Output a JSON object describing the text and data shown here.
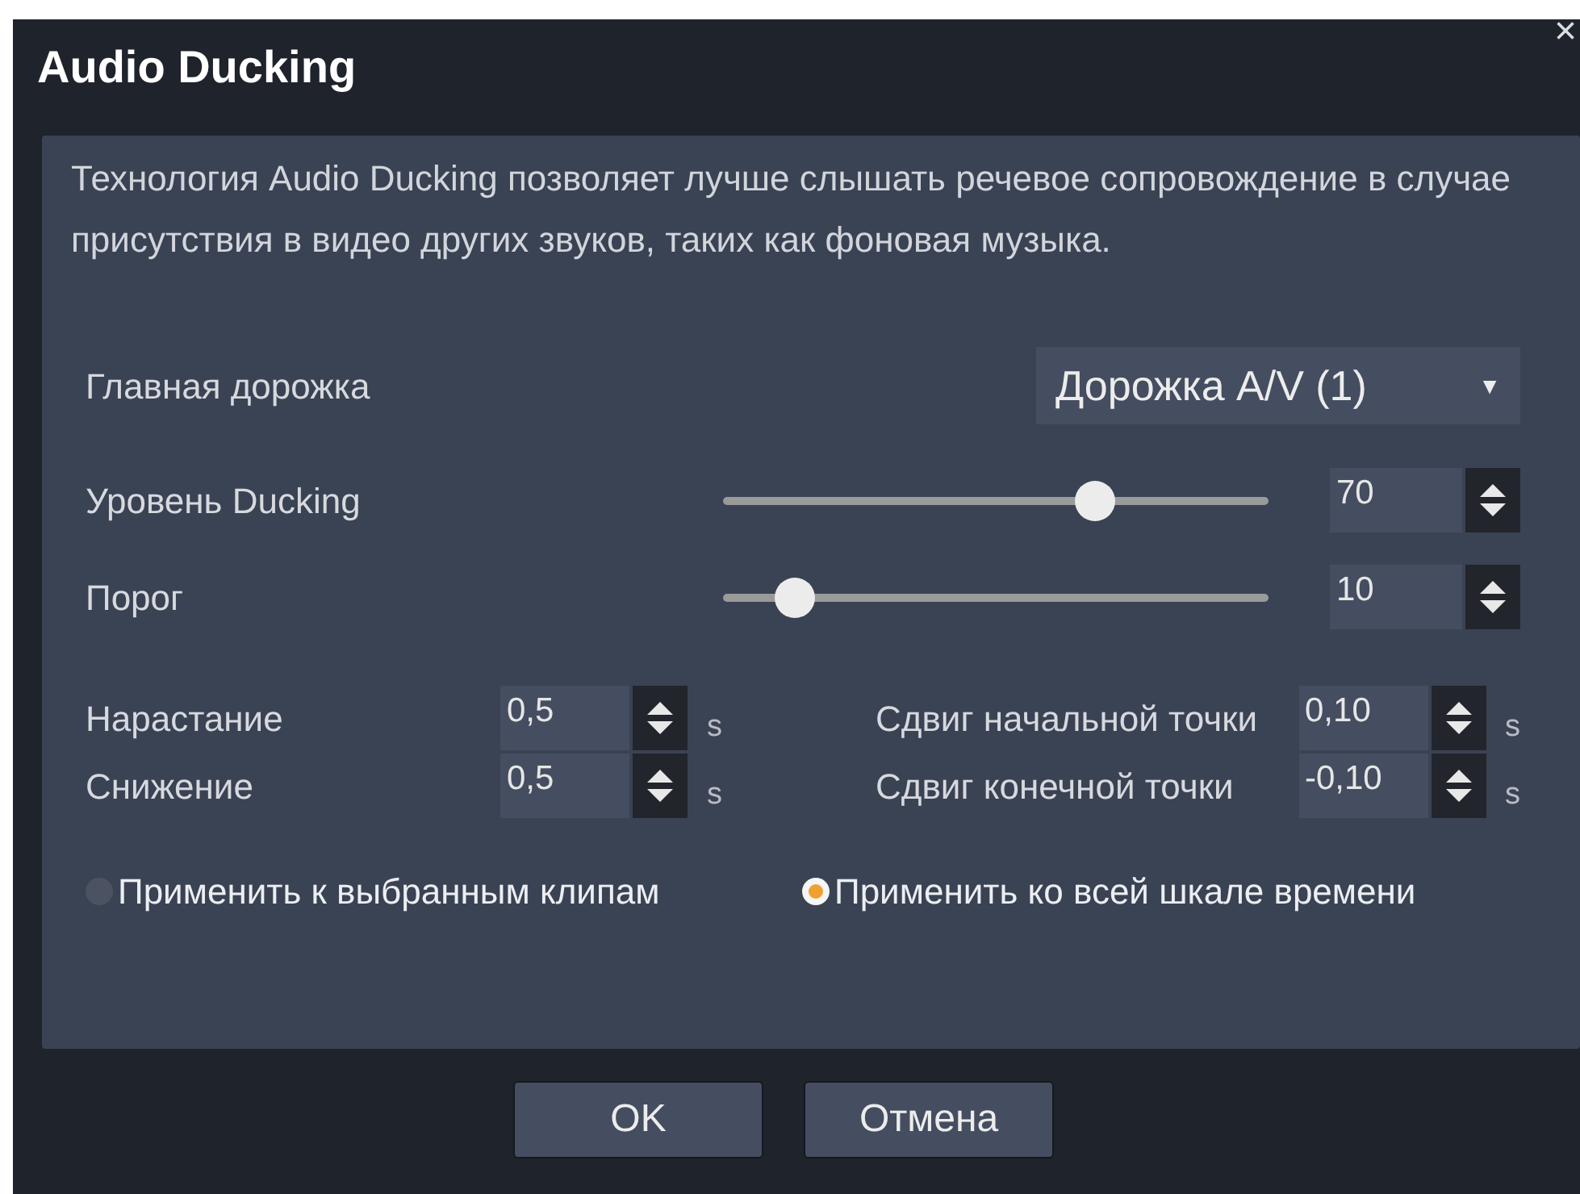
{
  "window": {
    "title": "Audio Ducking",
    "close": "×"
  },
  "description": "Технология Audio Ducking позволяет лучше слышать речевое сопровождение в случае присутствия в видео других звуков, таких как фоновая музыка.",
  "main_track": {
    "label": "Главная дорожка",
    "value": "Дорожка A/V (1)",
    "caret": "▼"
  },
  "sliders": [
    {
      "label": "Уровень Ducking",
      "level": 0.68,
      "value": "70"
    },
    {
      "label": "Порог",
      "level": 0.13,
      "value": "10"
    }
  ],
  "timing": [
    {
      "label": "Нарастание",
      "value": "0,5",
      "unit": "s"
    },
    {
      "label": "Сдвиг начальной точки",
      "value": "0,10",
      "unit": "s"
    },
    {
      "label": "Снижение",
      "value": "0,5",
      "unit": "s"
    },
    {
      "label": "Сдвиг конечной точки",
      "value": "-0,10",
      "unit": "s"
    }
  ],
  "scope": [
    {
      "label": "Применить к выбранным клипам",
      "selected": false
    },
    {
      "label": "Применить ко всей шкале времени",
      "selected": true
    }
  ],
  "buttons": [
    "OK",
    "Отмена"
  ]
}
